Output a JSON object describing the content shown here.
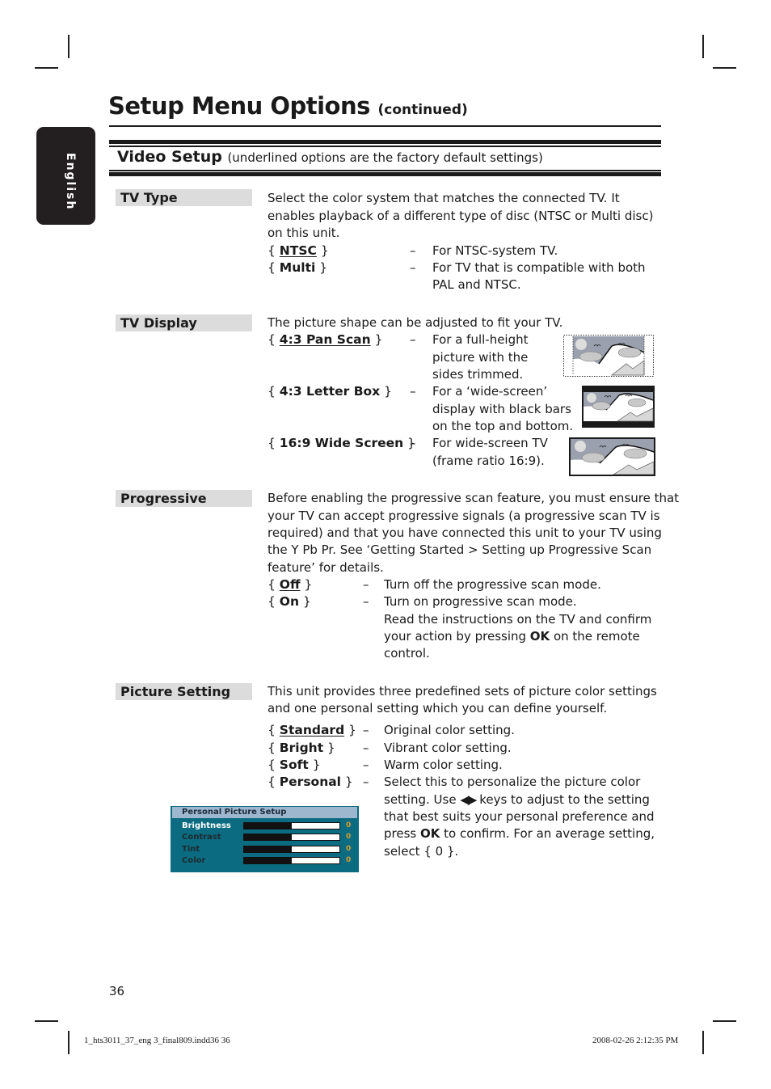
{
  "page": {
    "title": "Setup Menu Options",
    "title_suffix": "(continued)",
    "language_tab": "English",
    "page_number": "36",
    "slug_left": "1_hts3011_37_eng 3_final809.indd36   36",
    "slug_right": "2008-02-26   2:12:35 PM"
  },
  "section": {
    "title": "Video Setup",
    "note": "(underlined options are the factory default settings)"
  },
  "tv_type": {
    "label": "TV Type",
    "desc_lines": [
      "Select the color system that matches the connected TV. It",
      "enables playback of a different type of disc (NTSC or Multi disc)",
      "on this unit."
    ],
    "options": [
      {
        "name": "NTSC",
        "default": true,
        "desc_lines": [
          "For NTSC-system TV."
        ]
      },
      {
        "name": "Multi",
        "default": false,
        "desc_lines": [
          "For TV that is compatible with both",
          "PAL and NTSC."
        ]
      }
    ]
  },
  "tv_display": {
    "label": "TV Display",
    "desc": "The picture shape can be adjusted to fit your TV.",
    "options": [
      {
        "name": "4:3 Pan Scan",
        "default": true,
        "desc_lines": [
          "For a full-height",
          "picture with the",
          "sides trimmed."
        ],
        "icon": "pan-scan-picture"
      },
      {
        "name": "4:3 Letter Box",
        "default": false,
        "desc_lines": [
          "For a ‘wide-screen’",
          "display with black bars",
          "on the top and bottom."
        ],
        "icon": "letter-box-picture"
      },
      {
        "name": "16:9 Wide Screen",
        "default": false,
        "desc_lines": [
          "For wide-screen TV",
          "(frame ratio 16:9)."
        ],
        "icon": "wide-screen-picture"
      }
    ]
  },
  "progressive": {
    "label": "Progressive",
    "desc_lines": [
      "Before enabling the progressive scan feature, you must ensure that",
      "your TV can accept progressive signals (a progressive scan TV is",
      "required) and that you have connected this unit to your TV using",
      "the Y Pb Pr. See ‘Getting Started > Setting up Progressive Scan",
      "feature’ for details."
    ],
    "options": [
      {
        "name": "Off",
        "default": true,
        "desc_lines": [
          "Turn off the progressive scan mode."
        ]
      },
      {
        "name": "On",
        "default": false,
        "desc_lines": [
          "Turn on progressive scan mode.",
          "Read the instructions on the TV and confirm"
        ]
      }
    ],
    "on_line3_pre": "your action by pressing ",
    "on_line3_bold": "OK",
    "on_line3_post": " on the remote",
    "on_line4": "control."
  },
  "picture_setting": {
    "label": "Picture Setting",
    "desc_lines": [
      "This unit provides three predefined sets of picture color settings",
      "and one personal setting which you can define yourself."
    ],
    "options": [
      {
        "name": "Standard",
        "default": true,
        "desc": "Original color setting."
      },
      {
        "name": "Bright",
        "default": false,
        "desc": "Vibrant color setting."
      },
      {
        "name": "Soft",
        "default": false,
        "desc": "Warm color setting."
      },
      {
        "name": "Personal",
        "default": false,
        "desc": "Select this to personalize the picture color"
      }
    ],
    "personal_lines": {
      "l2_pre": "setting. Use ",
      "l2_keys": "◀▶",
      "l2_post": " keys to adjust to the setting",
      "l3": "that best suits your personal preference and",
      "l4_pre": "press ",
      "l4_bold": "OK",
      "l4_post": " to confirm. For an average setting,",
      "l5": "select { 0 }."
    }
  },
  "personal_picture_setup": {
    "title": "Personal Picture Setup",
    "rows": [
      {
        "label": "Brightness",
        "value": "0",
        "level": 0.5,
        "active": true
      },
      {
        "label": "Contrast",
        "value": "0",
        "level": 0.5,
        "active": false
      },
      {
        "label": "Tint",
        "value": "0",
        "level": 0.5,
        "active": false
      },
      {
        "label": "Color",
        "value": "0",
        "level": 0.5,
        "active": false
      }
    ]
  }
}
